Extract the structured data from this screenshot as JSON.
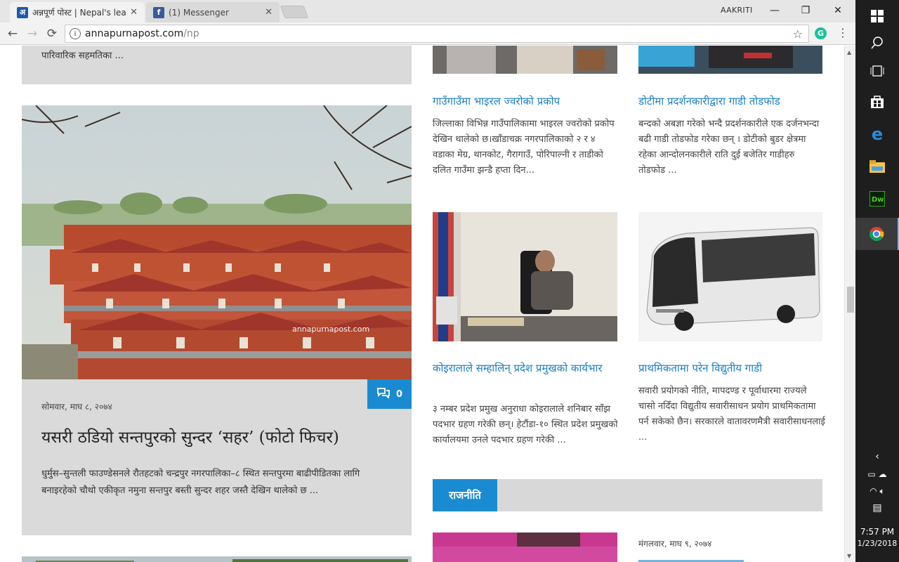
{
  "browser": {
    "tabs": [
      {
        "title": "अन्नपूर्ण पोस्ट | Nepal's lea",
        "favicon": "अ",
        "favicon_color": "#1e5aa8",
        "active": true
      },
      {
        "title": "(1) Messenger",
        "favicon": "f",
        "favicon_color": "#3b5998",
        "active": false
      }
    ],
    "user": "AAKRITI",
    "url_host": "annapurnapost.com",
    "url_path": "/np",
    "window_controls": [
      "—",
      "❐",
      "✕"
    ]
  },
  "page": {
    "top_card_excerpt": "पारिवारिक सहमतिका ...",
    "feature": {
      "date": "सोमवार, माघ ८, २०७४",
      "headline": "यसरी ठडियो सन्तपुरको सुन्दर ‘सहर’ (फोटो फिचर)",
      "excerpt": "धुर्मुस–सुन्तली फाउण्डेसनले रौतहटको चन्द्रपुर नगरपालिका–८ स्थित सन्तपुरमा बाढीपीडितका लागि बनाइरहेको चौथो एकीकृत नमुना सन्तपुर बस्ती सुन्दर शहर जस्तै देखिन थालेको छ ...",
      "comment_count": "0",
      "watermark": "annapurnapost.com"
    },
    "grid": [
      {
        "title": "गाउँगाउँमा भाइरल ज्वरोको प्रकोप",
        "excerpt": " जिल्लाका विभिन्न गाउँपालिकामा भाइरल ज्वरोको प्रकोप देखिन थालेको छ।खाँडाचक्र नगरपालिकाको २ र ४ वडाका मेग्र, थानकोट, गैरागाउँ, पोरिपाल्नी र ताडीको दलित गाउँमा झन्डै हप्ता दिन..."
      },
      {
        "title": "डोटीमा प्रदर्शनकारीद्वारा गाडी तोडफोड",
        "excerpt": "बन्दको अबज्ञा गरेको भन्दै प्रदर्शनकारीले एक दर्जनभन्दा बढी गाडी तोडफोड गरेका छन् । डोटीको बुडर क्षेत्रमा रहेका आन्दोलनकारीले राति दुई बजेतिर गाडीहरु तोडफोड ..."
      },
      {
        "title": "कोइरालाले सम्हालिन् प्रदेश प्रमुखको कार्यभार",
        "excerpt": " ३ नम्बर प्रदेश प्रमुख अनुराधा कोइरालाले शनिबार साँझ पदभार ग्रहण गरेकी छन्। हेटौंडा-१० स्थित प्रदेश प्रमुखको कार्यालयमा उनले पदभार ग्रहण गरेकी ..."
      },
      {
        "title": "प्राथमिकतामा परेन विद्युतीय गाडी",
        "excerpt": "सवारी प्रयोगको नीति, मापदण्ड र पूर्वाधारमा राज्यले चासो नदिँदा विद्युतीय सवारीसाधन प्रयोग प्राथमिकतामा पर्न सकेको छैन। सरकारले वातावरणमैत्री सवारीसाधनलाई ..."
      }
    ],
    "section_label": "राजनीति",
    "politics_date": "मंगलवार, माघ ९, २०७४"
  },
  "taskbar": {
    "time": "7:57 PM",
    "date": "1/23/2018",
    "accent": "#1a8bd0"
  }
}
